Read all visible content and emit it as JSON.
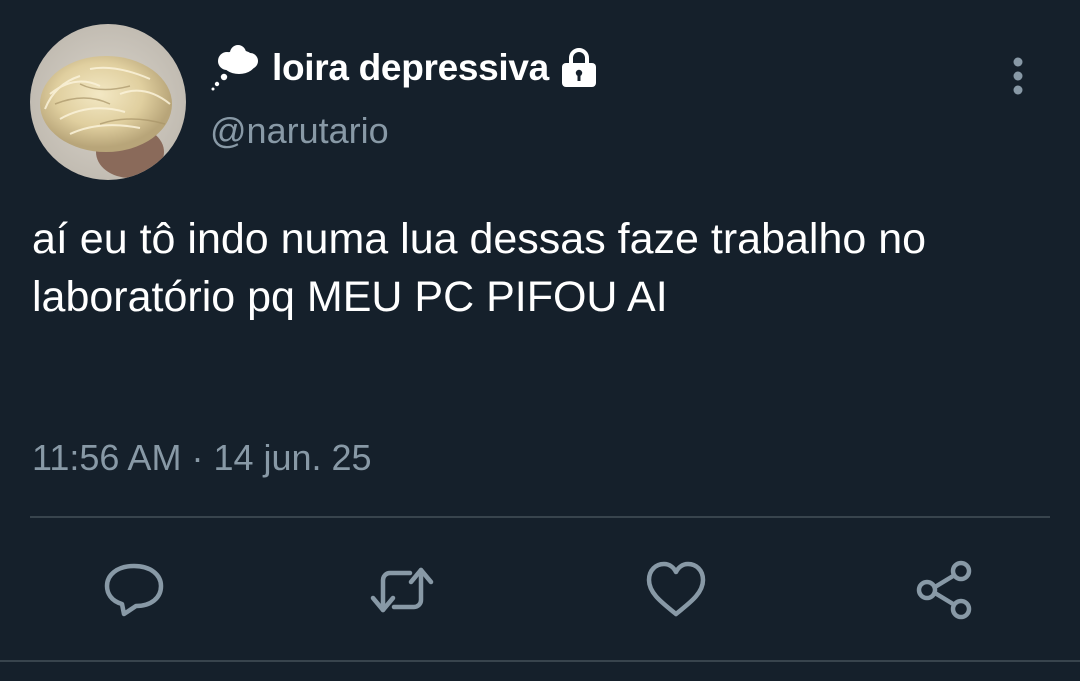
{
  "user": {
    "display_name": "loira depressiva",
    "handle": "@narutario",
    "emoji_icon": "thought-balloon-icon",
    "protected_icon": "lock-icon"
  },
  "tweet": {
    "text": "aí eu tô indo numa lua dessas faze trabalho no laboratório pq MEU PC PIFOU AI",
    "time": "11:56 AM",
    "separator": " · ",
    "date": "14 jun. 25"
  },
  "actions": [
    "reply-icon",
    "retweet-icon",
    "like-icon",
    "share-icon"
  ],
  "colors": {
    "background": "#15202b",
    "primary_text": "#ffffff",
    "secondary_text": "#8899a6",
    "divider": "#38444d"
  }
}
